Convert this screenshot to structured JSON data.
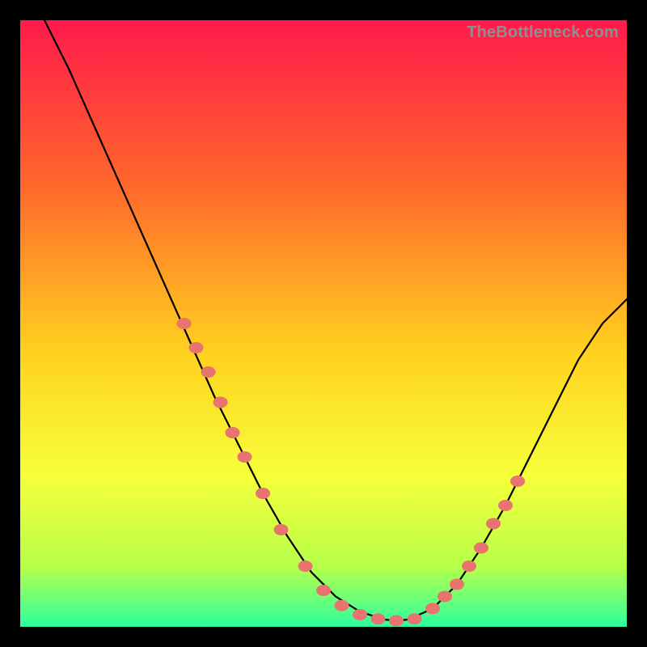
{
  "watermark": "TheBottleneck.com",
  "colors": {
    "bg": "#000000",
    "gradient_top": "#ff1a4b",
    "gradient_mid1": "#ff6a2a",
    "gradient_mid2": "#ffd21f",
    "gradient_mid3": "#f7ff3a",
    "gradient_mid4": "#b7ff4a",
    "gradient_bot": "#2dff9e",
    "curve": "#000000",
    "marker": "#e9736e"
  },
  "chart_data": {
    "type": "line",
    "title": "",
    "xlabel": "",
    "ylabel": "",
    "xlim": [
      0,
      100
    ],
    "ylim": [
      0,
      100
    ],
    "curve": {
      "x": [
        0,
        4,
        8,
        12,
        16,
        20,
        24,
        28,
        32,
        36,
        40,
        44,
        48,
        52,
        56,
        60,
        62,
        64,
        68,
        72,
        76,
        80,
        84,
        88,
        92,
        96,
        100
      ],
      "y": [
        108,
        100,
        92,
        83,
        74,
        65,
        56,
        47,
        38,
        30,
        22,
        15,
        9,
        5,
        2.5,
        1.2,
        1.0,
        1.2,
        3,
        7,
        13,
        20,
        28,
        36,
        44,
        50,
        54
      ]
    },
    "markers": {
      "x": [
        27,
        29,
        31,
        33,
        35,
        37,
        40,
        43,
        47,
        50,
        53,
        56,
        59,
        62,
        65,
        68,
        70,
        72,
        74,
        76,
        78,
        80,
        82
      ],
      "y": [
        50,
        46,
        42,
        37,
        32,
        28,
        22,
        16,
        10,
        6,
        3.5,
        2,
        1.3,
        1.0,
        1.3,
        3,
        5,
        7,
        10,
        13,
        17,
        20,
        24
      ]
    }
  }
}
